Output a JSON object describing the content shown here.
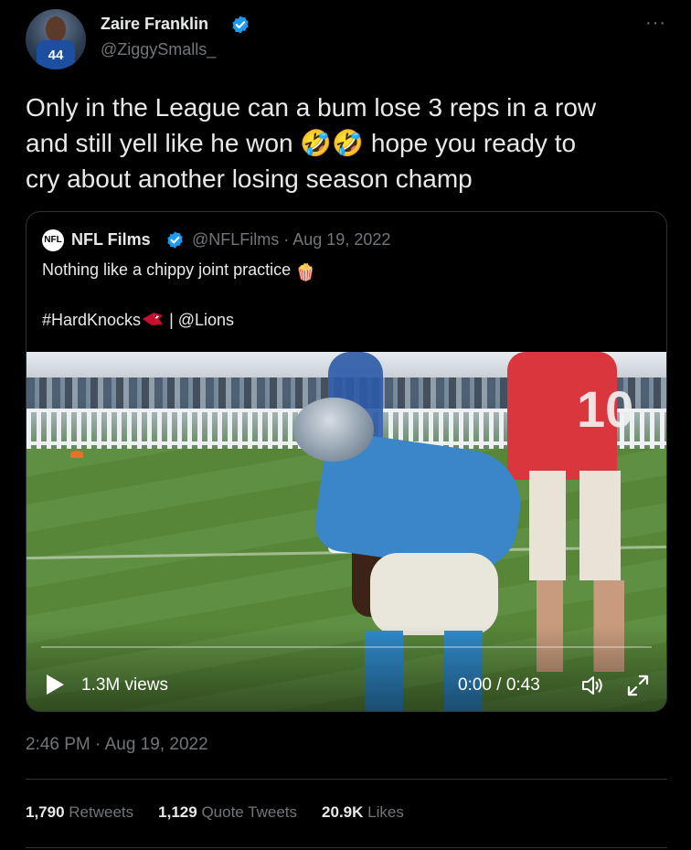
{
  "author": {
    "name": "Zaire Franklin",
    "handle": "@ZiggySmalls_",
    "avatar_jersey_number": "44"
  },
  "tweet": {
    "text_line1": "Only in the League can a bum lose 3 reps in a row",
    "text_line2_a": "and still yell like he won",
    "text_line2_b": "hope you ready to",
    "text_line3": "cry about another losing season champ",
    "emoji": "🤣🤣"
  },
  "quote": {
    "logo_text": "NFL",
    "name": "NFL Films",
    "handle_date": "@NFLFilms · Aug 19, 2022",
    "text": "Nothing like a chippy joint practice",
    "text_emoji": "🍿",
    "tags": "#HardKnocks",
    "tags_rest": "| @Lions",
    "video": {
      "views": "1.3M views",
      "time": "0:00 / 0:43",
      "progress": 0.0,
      "jersey_number": "10"
    }
  },
  "timestamp": "2:46 PM · Aug 19, 2022",
  "stats": {
    "retweets_count": "1,790",
    "retweets_label": "Retweets",
    "quotes_count": "1,129",
    "quotes_label": "Quote Tweets",
    "likes_count": "20.9K",
    "likes_label": "Likes"
  },
  "colors": {
    "background": "#000000",
    "text": "#e7e9ea",
    "muted": "#71767b",
    "verified": "#1d9bf0",
    "border": "#2f3336"
  },
  "icons": [
    "verified-badge-icon",
    "more-icon",
    "play-icon",
    "volume-icon",
    "fullscreen-icon",
    "cardinals-logo-icon"
  ]
}
